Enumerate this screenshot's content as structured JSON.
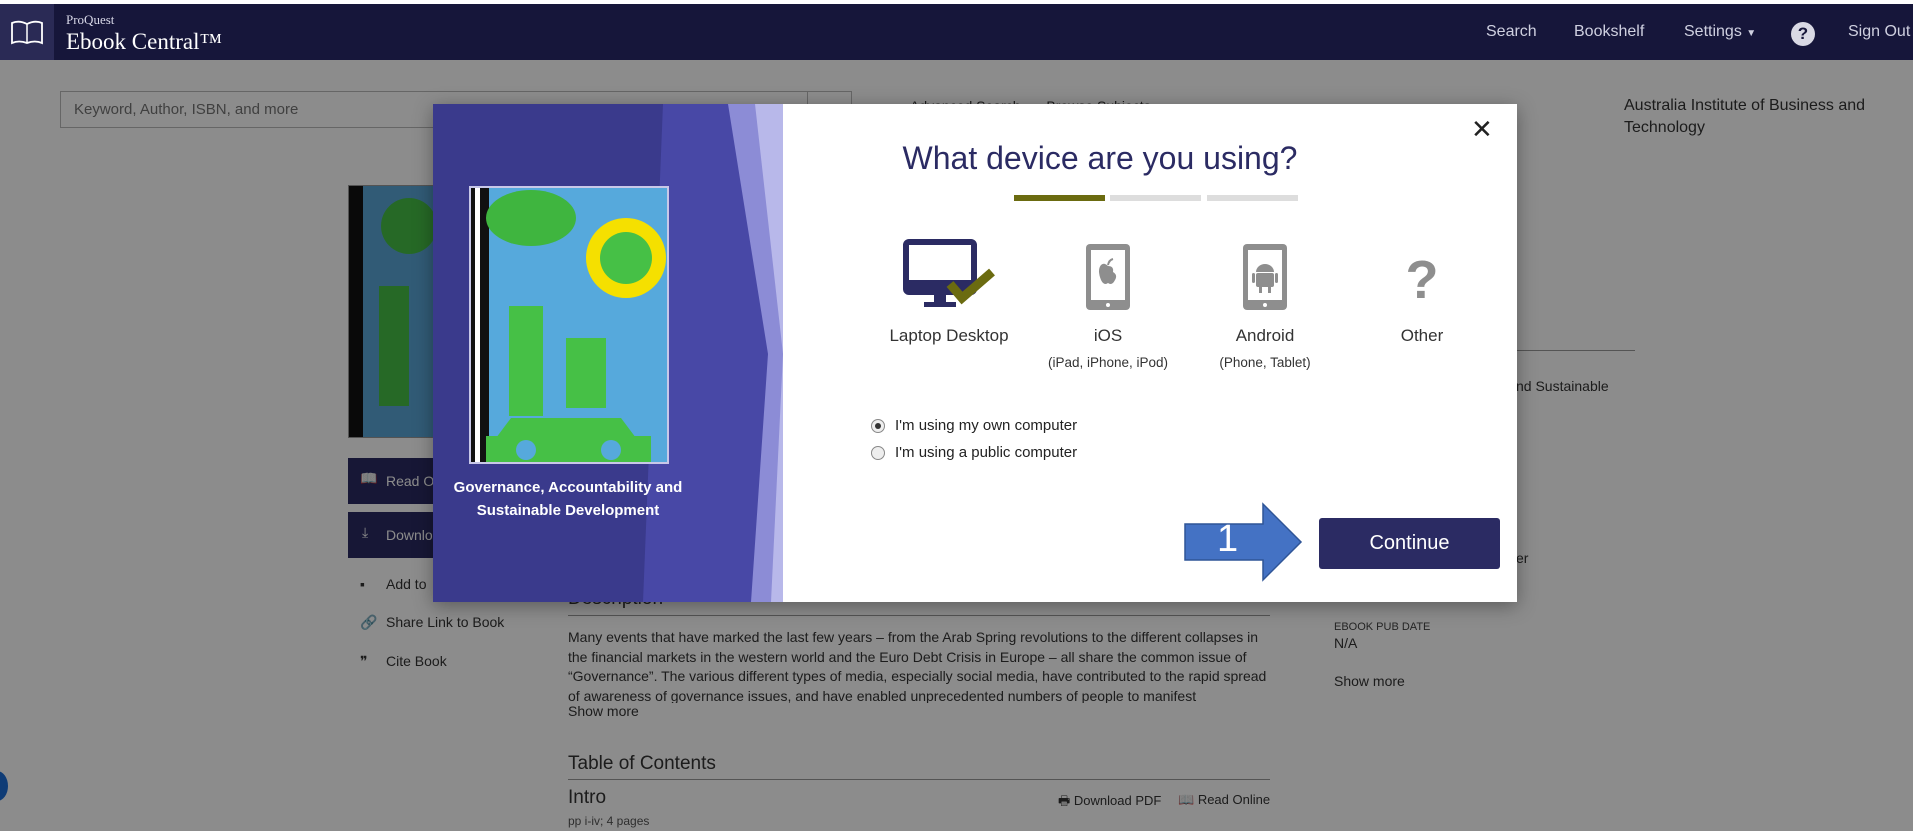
{
  "header": {
    "brand_small": "ProQuest",
    "brand_big": "Ebook Central™",
    "nav": {
      "search": "Search",
      "bookshelf": "Bookshelf",
      "settings": "Settings",
      "help": "?",
      "signout": "Sign Out"
    }
  },
  "search": {
    "placeholder": "Keyword, Author, ISBN, and more",
    "advanced": "Advanced Search",
    "browse": "Browse Subjects"
  },
  "institution": "Australia Institute of Business and Technology",
  "book_actions": {
    "read_online": "Read O",
    "download": "Downlo",
    "add_to": "Add to",
    "share_link": "Share Link to Book",
    "cite_book": "Cite Book"
  },
  "description": {
    "heading": "Description",
    "text": "Many events that have marked the last few years – from the Arab Spring revolutions to the different collapses in the financial markets in the western world and the Euro Debt Crisis in Europe – all share the common issue of “Governance”. The various different types of media, especially social media, have contributed to the rapid spread of awareness of governance issues, and have enabled unprecedented numbers of people to manifest",
    "show_more": "Show more"
  },
  "toc": {
    "heading": "Table of Contents",
    "item_title": "Intro",
    "item_pages": "pp i-iv; 4 pages",
    "download_pdf": "Download PDF",
    "read_online": "Read Online"
  },
  "right_panel": {
    "partial_title": "nd Sustainable",
    "partial_other": "er",
    "pub_date_label": "EBOOK PUB DATE",
    "pub_date_value": "N/A",
    "show_more": "Show more"
  },
  "modal": {
    "title": "What device are you using?",
    "book_title": "Governance, Accountability and Sustainable Development",
    "progress_step": 1,
    "progress_total": 3,
    "devices": [
      {
        "label": "Laptop Desktop",
        "sub": "",
        "icon": "laptop-desktop-icon",
        "selected": true
      },
      {
        "label": "iOS",
        "sub": "(iPad, iPhone, iPod)",
        "icon": "apple-tablet-icon",
        "selected": false
      },
      {
        "label": "Android",
        "sub": "(Phone, Tablet)",
        "icon": "android-tablet-icon",
        "selected": false
      },
      {
        "label": "Other",
        "sub": "",
        "icon": "question-icon",
        "selected": false
      }
    ],
    "radio_own": "I'm using my own computer",
    "radio_public": "I'm using a public computer",
    "continue": "Continue",
    "annotation_number": "1"
  },
  "colors": {
    "navy": "#2b2b63",
    "topbar": "#16163a",
    "olive": "#6b6b10",
    "annotation_blue": "#4472c4"
  }
}
